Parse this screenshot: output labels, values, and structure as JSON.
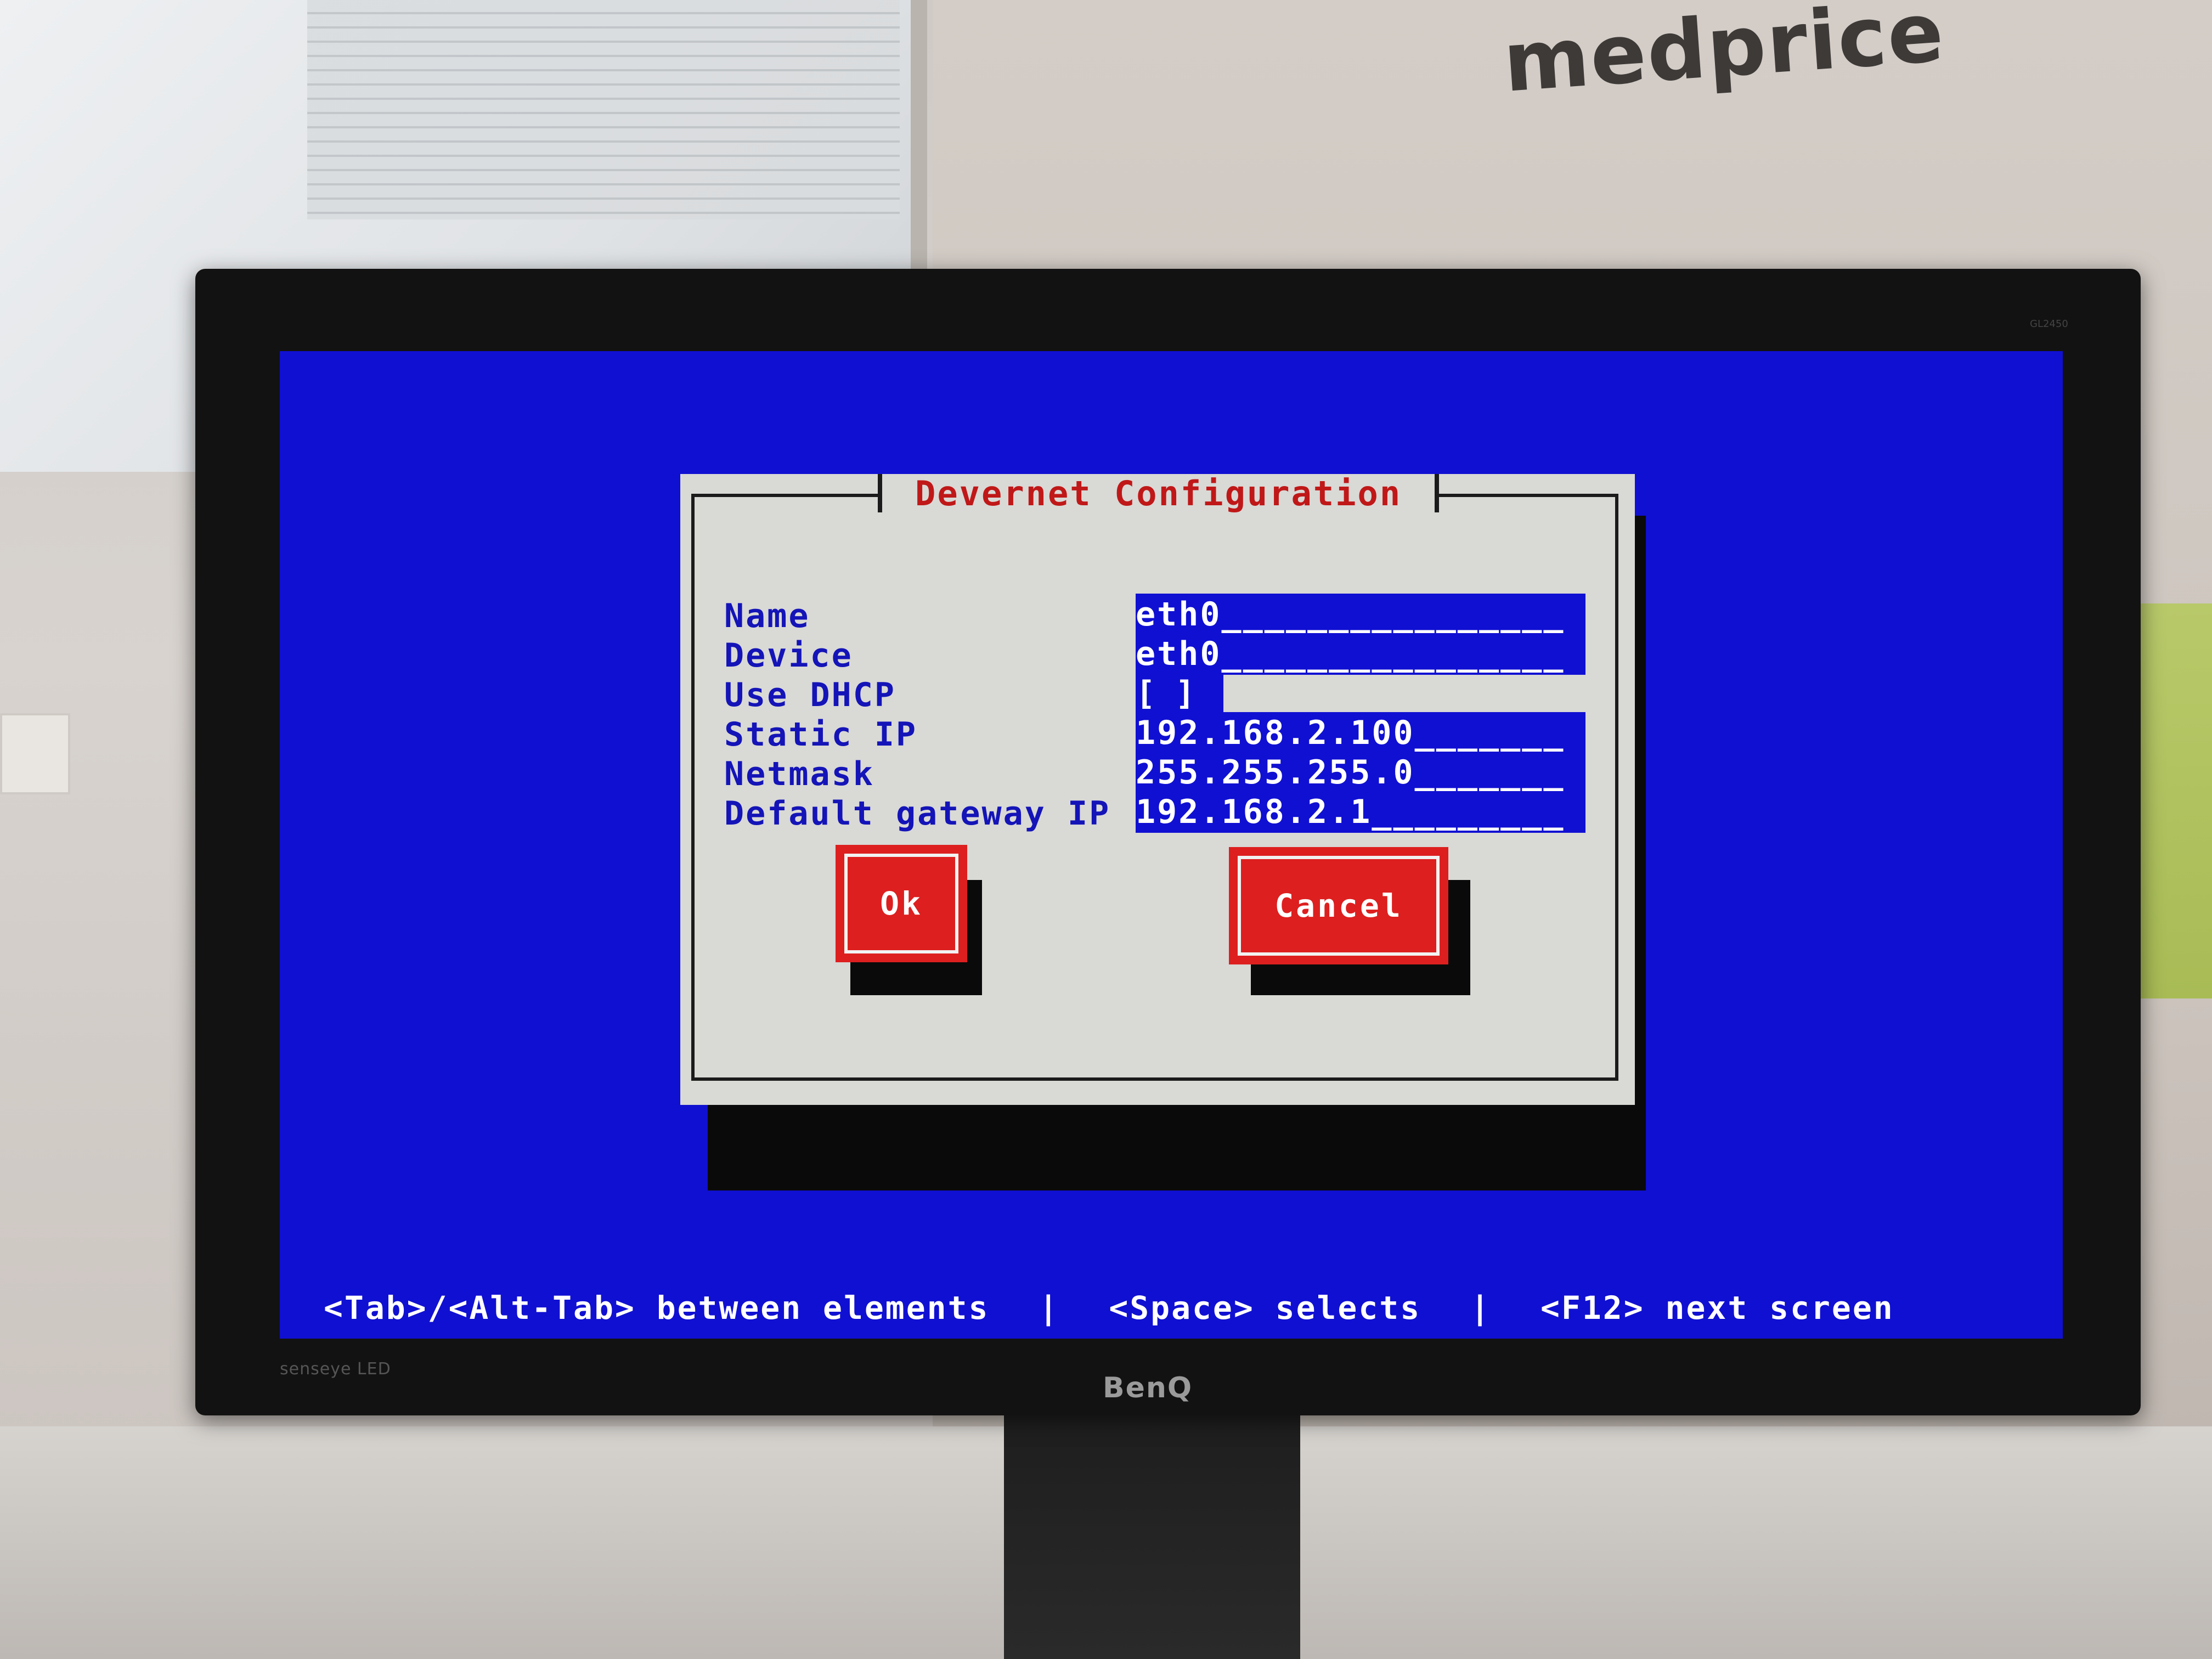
{
  "photo": {
    "wall_sign_text": "medprice",
    "monitor_brand": "BenQ",
    "monitor_tagline": "senseye LED",
    "monitor_model": "GL2450"
  },
  "dialog": {
    "title": "Devernet Configuration",
    "fields": [
      {
        "label": "Name",
        "value": "eth0________________"
      },
      {
        "label": "Device",
        "value": "eth0________________"
      },
      {
        "label": "Use DHCP",
        "value": "[ ]"
      },
      {
        "label": "Static IP",
        "value": "192.168.2.100_______"
      },
      {
        "label": "Netmask",
        "value": "255.255.255.0_______"
      },
      {
        "label": "Default gateway IP",
        "value": "192.168.2.1_________"
      }
    ],
    "ok_label": "Ok",
    "cancel_label": "Cancel"
  },
  "status_bar": {
    "tab_hint": "<Tab>/<Alt-Tab> between elements",
    "separator": "|",
    "space_hint": "<Space> selects",
    "f12_hint": "<F12> next screen"
  },
  "colors": {
    "screen_background": "#1010d2",
    "dialog_background": "#d9d9d6",
    "title_color": "#c01818",
    "button_color": "#dd1f1f"
  }
}
